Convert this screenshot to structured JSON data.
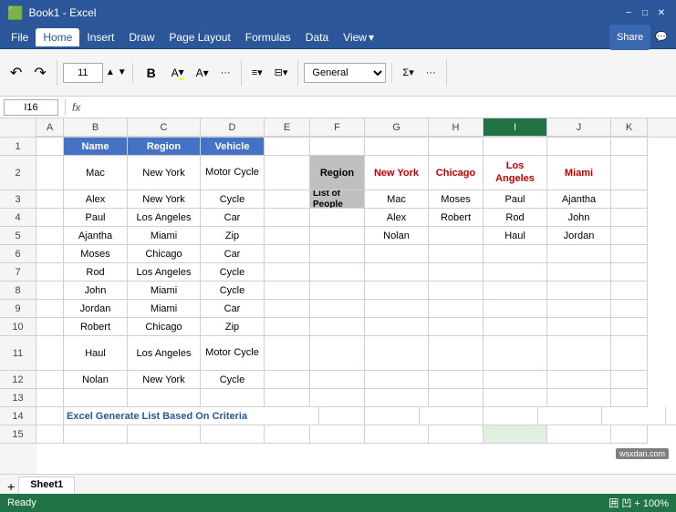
{
  "app": {
    "title": "Microsoft Excel",
    "file_name": "Book1 - Excel"
  },
  "menu": {
    "items": [
      "File",
      "Home",
      "Insert",
      "Draw",
      "Page Layout",
      "Formulas",
      "Data",
      "View"
    ]
  },
  "ribbon": {
    "font_size": "11",
    "font_name": "Calibri",
    "number_format": "General",
    "bold_label": "B",
    "undo_label": "↶",
    "redo_label": "↷"
  },
  "formula_bar": {
    "cell_ref": "I16",
    "fx_label": "fx"
  },
  "columns": {
    "headers": [
      "A",
      "B",
      "C",
      "D",
      "E",
      "F",
      "G",
      "H",
      "I",
      "J",
      "K"
    ],
    "widths": [
      30,
      70,
      80,
      70,
      50,
      60,
      70,
      60,
      70,
      70,
      40
    ]
  },
  "rows": {
    "count": 15,
    "height": 20
  },
  "cells": {
    "row1": {
      "b": "Name",
      "c": "Region",
      "d": "Vehicle",
      "f": "",
      "g": "",
      "h": "",
      "i": "",
      "j": ""
    },
    "row2": {
      "b": "Mac",
      "c": "New York",
      "d": "Motor\nCycle",
      "f": "Region",
      "g": "New York",
      "h": "Chicago",
      "i": "Los\nAngeles",
      "j": "Miami"
    },
    "row3": {
      "b": "Alex",
      "c": "New York",
      "d": "Cycle",
      "f": "List of\nPeople",
      "g": "Mac",
      "h": "Moses",
      "i": "Paul",
      "j": "Ajantha"
    },
    "row4": {
      "b": "Paul",
      "c": "Los Angeles",
      "d": "Car",
      "f": "",
      "g": "Alex",
      "h": "Robert",
      "i": "Rod",
      "j": "John"
    },
    "row5": {
      "b": "Ajantha",
      "c": "Miami",
      "d": "Zip",
      "f": "",
      "g": "Nolan",
      "h": "",
      "i": "Haul",
      "j": "Jordan"
    },
    "row6": {
      "b": "Moses",
      "c": "Chicago",
      "d": "Car",
      "f": "",
      "g": "",
      "h": "",
      "i": "",
      "j": ""
    },
    "row7": {
      "b": "Rod",
      "c": "Los Angeles",
      "d": "Cycle",
      "f": "",
      "g": "",
      "h": "",
      "i": "",
      "j": ""
    },
    "row8": {
      "b": "John",
      "c": "Miami",
      "d": "Cycle",
      "f": "",
      "g": "",
      "h": "",
      "i": "",
      "j": ""
    },
    "row9": {
      "b": "Jordan",
      "c": "Miami",
      "d": "Car",
      "f": "",
      "g": "",
      "h": "",
      "i": "",
      "j": ""
    },
    "row10": {
      "b": "Robert",
      "c": "Chicago",
      "d": "Zip",
      "f": "",
      "g": "",
      "h": "",
      "i": "",
      "j": ""
    },
    "row11": {
      "b": "Haul",
      "c": "Los Angeles",
      "d": "Motor\nCycle",
      "f": "",
      "g": "",
      "h": "",
      "i": "",
      "j": ""
    },
    "row12": {
      "b": "Nolan",
      "c": "New York",
      "d": "Cycle",
      "f": "",
      "g": "",
      "h": "",
      "i": "",
      "j": ""
    },
    "row13": {
      "b": "",
      "c": "",
      "d": "",
      "f": "",
      "g": "",
      "h": "",
      "i": "",
      "j": ""
    },
    "row14": {
      "b": "Excel Generate List Based On Criteria",
      "c": "",
      "d": ""
    },
    "row15": {
      "b": "",
      "c": "",
      "d": ""
    }
  },
  "sheet_tab": {
    "name": "Sheet1"
  },
  "status": {
    "left": "Ready",
    "right": "囲 凹 + 100%"
  },
  "colors": {
    "accent": "#2b579a",
    "green": "#217346",
    "red": "#c00000",
    "header_bg": "#bfbfbf",
    "grid_line": "#d0d0d0",
    "selected_col": "#217346"
  }
}
